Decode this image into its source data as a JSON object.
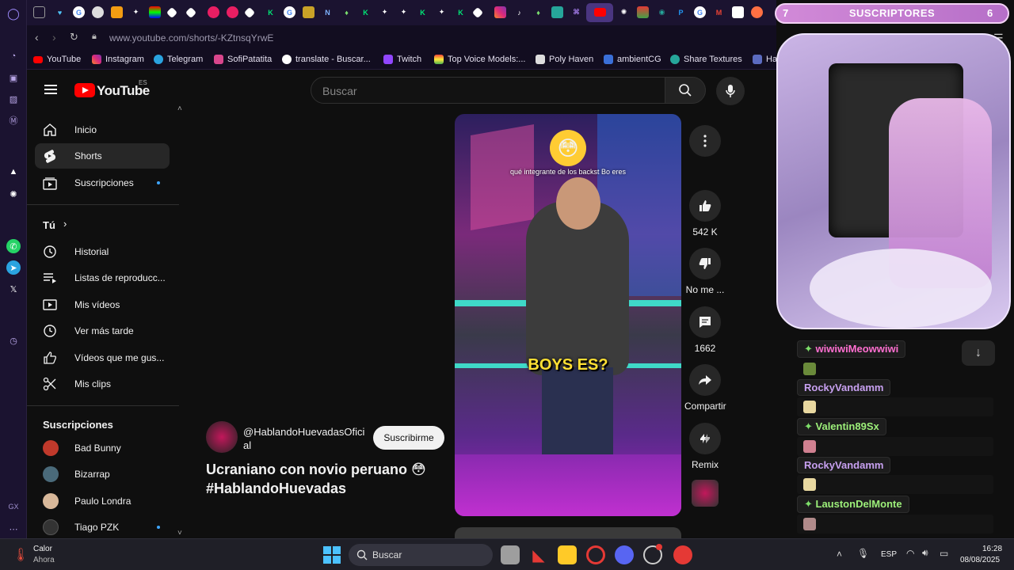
{
  "browser": {
    "url": "www.youtube.com/shorts/-KZtnsqYrwE",
    "bookmarks": [
      "YouTube",
      "Instagram",
      "Telegram",
      "SofiPatatita",
      "translate - Buscar...",
      "Twitch",
      "Top Voice Models:...",
      "Poly Haven",
      "ambientCG",
      "Share Textures",
      "Ha"
    ]
  },
  "youtube": {
    "logo": "YouTube",
    "region": "ES",
    "search_placeholder": "Buscar",
    "nav": [
      {
        "label": "Inicio",
        "icon": "home-icon"
      },
      {
        "label": "Shorts",
        "icon": "shorts-icon"
      },
      {
        "label": "Suscripciones",
        "icon": "subscriptions-icon"
      }
    ],
    "you_section": "Tú",
    "you_items": [
      {
        "label": "Historial",
        "icon": "history-icon"
      },
      {
        "label": "Listas de reproducc...",
        "icon": "playlist-icon"
      },
      {
        "label": "Mis vídeos",
        "icon": "my-videos-icon"
      },
      {
        "label": "Ver más tarde",
        "icon": "watch-later-icon"
      },
      {
        "label": "Vídeos que me gus...",
        "icon": "liked-icon"
      },
      {
        "label": "Mis clips",
        "icon": "clips-icon"
      }
    ],
    "subs_title": "Suscripciones",
    "subs": [
      {
        "name": "Bad Bunny",
        "color": "#c0392b"
      },
      {
        "name": "Bizarrap",
        "color": "#4a6a7a"
      },
      {
        "name": "Paulo Londra",
        "color": "#d8b89a"
      },
      {
        "name": "Tiago PZK",
        "color": "#333333"
      }
    ]
  },
  "short": {
    "caption_top": "qué integrante de los backst Bo eres",
    "caption_big": "BOYS ES?",
    "channel": "@HablandoHuevadasOficial",
    "subscribe": "Suscribirme",
    "title": "Ucraniano con novio peruano 😳 #HablandoHuevadas",
    "likes": "542 K",
    "dislike": "No me ...",
    "comments": "1662",
    "share": "Compartir",
    "remix": "Remix"
  },
  "overlay": {
    "subs_left": "7",
    "subs_label": "SUSCRIPTORES",
    "subs_right": "6",
    "chat": [
      {
        "user": "wiwiwiMeowwiwi",
        "color": "#ff6fd0",
        "badge": true
      },
      {
        "user": "RockyVandamm",
        "color": "#c7a0f0",
        "badge": false
      },
      {
        "user": "Valentin89Sx",
        "color": "#9df07a",
        "badge": true
      },
      {
        "user": "RockyVandamm",
        "color": "#c7a0f0",
        "badge": false
      },
      {
        "user": "LaustonDelMonte",
        "color": "#9df07a",
        "badge": true
      }
    ]
  },
  "taskbar": {
    "weather_title": "Calor",
    "weather_sub": "Ahora",
    "search": "Buscar",
    "lang": "ESP",
    "time": "16:28",
    "date": "08/08/2025"
  }
}
